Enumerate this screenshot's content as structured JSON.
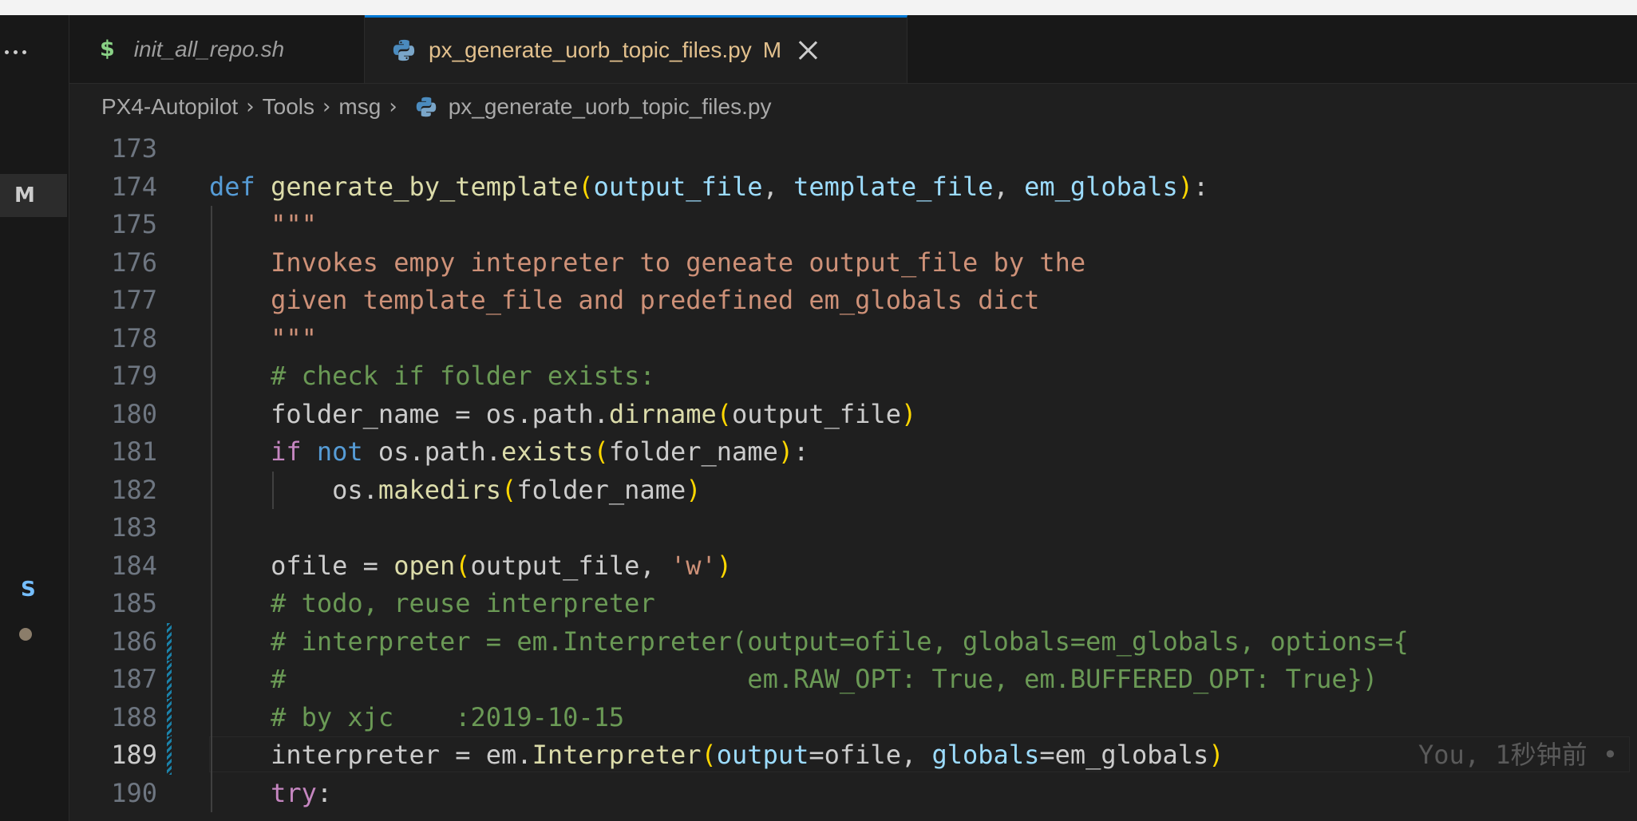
{
  "tabs": [
    {
      "icon": "$",
      "title": "init_all_repo.sh"
    },
    {
      "title": "px_generate_uorb_topic_files.py",
      "modified": "M"
    }
  ],
  "activity": {
    "badge_m": "M",
    "badge_s": "S"
  },
  "breadcrumb": [
    "PX4-Autopilot",
    "Tools",
    "msg",
    "px_generate_uorb_topic_files.py"
  ],
  "blame": "You, 1秒钟前 •",
  "lines": [
    {
      "n": "173",
      "tokens": []
    },
    {
      "n": "174",
      "tokens": [
        [
          "kw",
          "def"
        ],
        [
          "tx",
          " "
        ],
        [
          "fn",
          "generate_by_template"
        ],
        [
          "p1",
          "("
        ],
        [
          "pm",
          "output_file"
        ],
        [
          "tx",
          ", "
        ],
        [
          "pm",
          "template_file"
        ],
        [
          "tx",
          ", "
        ],
        [
          "pm",
          "em_globals"
        ],
        [
          "p1",
          ")"
        ],
        [
          "tx",
          ":"
        ]
      ]
    },
    {
      "n": "175",
      "tokens": [
        [
          "tx",
          "    "
        ],
        [
          "st",
          "\"\"\""
        ]
      ]
    },
    {
      "n": "176",
      "tokens": [
        [
          "tx",
          "    "
        ],
        [
          "st",
          "Invokes empy intepreter to geneate output_file by the"
        ]
      ]
    },
    {
      "n": "177",
      "tokens": [
        [
          "tx",
          "    "
        ],
        [
          "st",
          "given template_file and predefined em_globals dict"
        ]
      ]
    },
    {
      "n": "178",
      "tokens": [
        [
          "tx",
          "    "
        ],
        [
          "st",
          "\"\"\""
        ]
      ]
    },
    {
      "n": "179",
      "tokens": [
        [
          "tx",
          "    "
        ],
        [
          "cm",
          "# check if folder exists:"
        ]
      ]
    },
    {
      "n": "180",
      "tokens": [
        [
          "tx",
          "    folder_name = os.path."
        ],
        [
          "fn",
          "dirname"
        ],
        [
          "p1",
          "("
        ],
        [
          "tx",
          "output_file"
        ],
        [
          "p1",
          ")"
        ]
      ]
    },
    {
      "n": "181",
      "tokens": [
        [
          "tx",
          "    "
        ],
        [
          "kc",
          "if"
        ],
        [
          "tx",
          " "
        ],
        [
          "kw",
          "not"
        ],
        [
          "tx",
          " os.path."
        ],
        [
          "fn",
          "exists"
        ],
        [
          "p1",
          "("
        ],
        [
          "tx",
          "folder_name"
        ],
        [
          "p1",
          ")"
        ],
        [
          "tx",
          ":"
        ]
      ]
    },
    {
      "n": "182",
      "tokens": [
        [
          "tx",
          "        os."
        ],
        [
          "fn",
          "makedirs"
        ],
        [
          "p1",
          "("
        ],
        [
          "tx",
          "folder_name"
        ],
        [
          "p1",
          ")"
        ]
      ]
    },
    {
      "n": "183",
      "tokens": []
    },
    {
      "n": "184",
      "tokens": [
        [
          "tx",
          "    ofile = "
        ],
        [
          "fn",
          "open"
        ],
        [
          "p1",
          "("
        ],
        [
          "tx",
          "output_file, "
        ],
        [
          "st",
          "'w'"
        ],
        [
          "p1",
          ")"
        ]
      ]
    },
    {
      "n": "185",
      "tokens": [
        [
          "tx",
          "    "
        ],
        [
          "cm",
          "# todo, reuse interpreter"
        ]
      ]
    },
    {
      "n": "186",
      "tokens": [
        [
          "tx",
          "    "
        ],
        [
          "cm",
          "# interpreter = em.Interpreter(output=ofile, globals=em_globals, options={"
        ]
      ]
    },
    {
      "n": "187",
      "tokens": [
        [
          "tx",
          "    "
        ],
        [
          "cm",
          "#                              em.RAW_OPT: True, em.BUFFERED_OPT: True})"
        ]
      ]
    },
    {
      "n": "188",
      "tokens": [
        [
          "tx",
          "    "
        ],
        [
          "cm",
          "# by xjc    :2019-10-15"
        ]
      ]
    },
    {
      "n": "189",
      "tokens": [
        [
          "tx",
          "    interpreter = em."
        ],
        [
          "fn",
          "Interpreter"
        ],
        [
          "p1",
          "("
        ],
        [
          "pm",
          "output"
        ],
        [
          "tx",
          "=ofile, "
        ],
        [
          "pm",
          "globals"
        ],
        [
          "tx",
          "=em_globals"
        ],
        [
          "p1",
          ")"
        ]
      ]
    },
    {
      "n": "190",
      "tokens": [
        [
          "tx",
          "    "
        ],
        [
          "kc",
          "try"
        ],
        [
          "tx",
          ":"
        ]
      ]
    }
  ],
  "active_line": "189",
  "modified_lines": [
    "186",
    "187",
    "188",
    "189"
  ],
  "colors": {
    "accent": "#0078d4",
    "modified": "#e2c08d",
    "keyword": "#569cd6",
    "control": "#c586c0",
    "function": "#dcdcaa",
    "param": "#9cdcfe",
    "string": "#ce9178",
    "comment": "#6a9955",
    "bracket": "#ffd700"
  }
}
